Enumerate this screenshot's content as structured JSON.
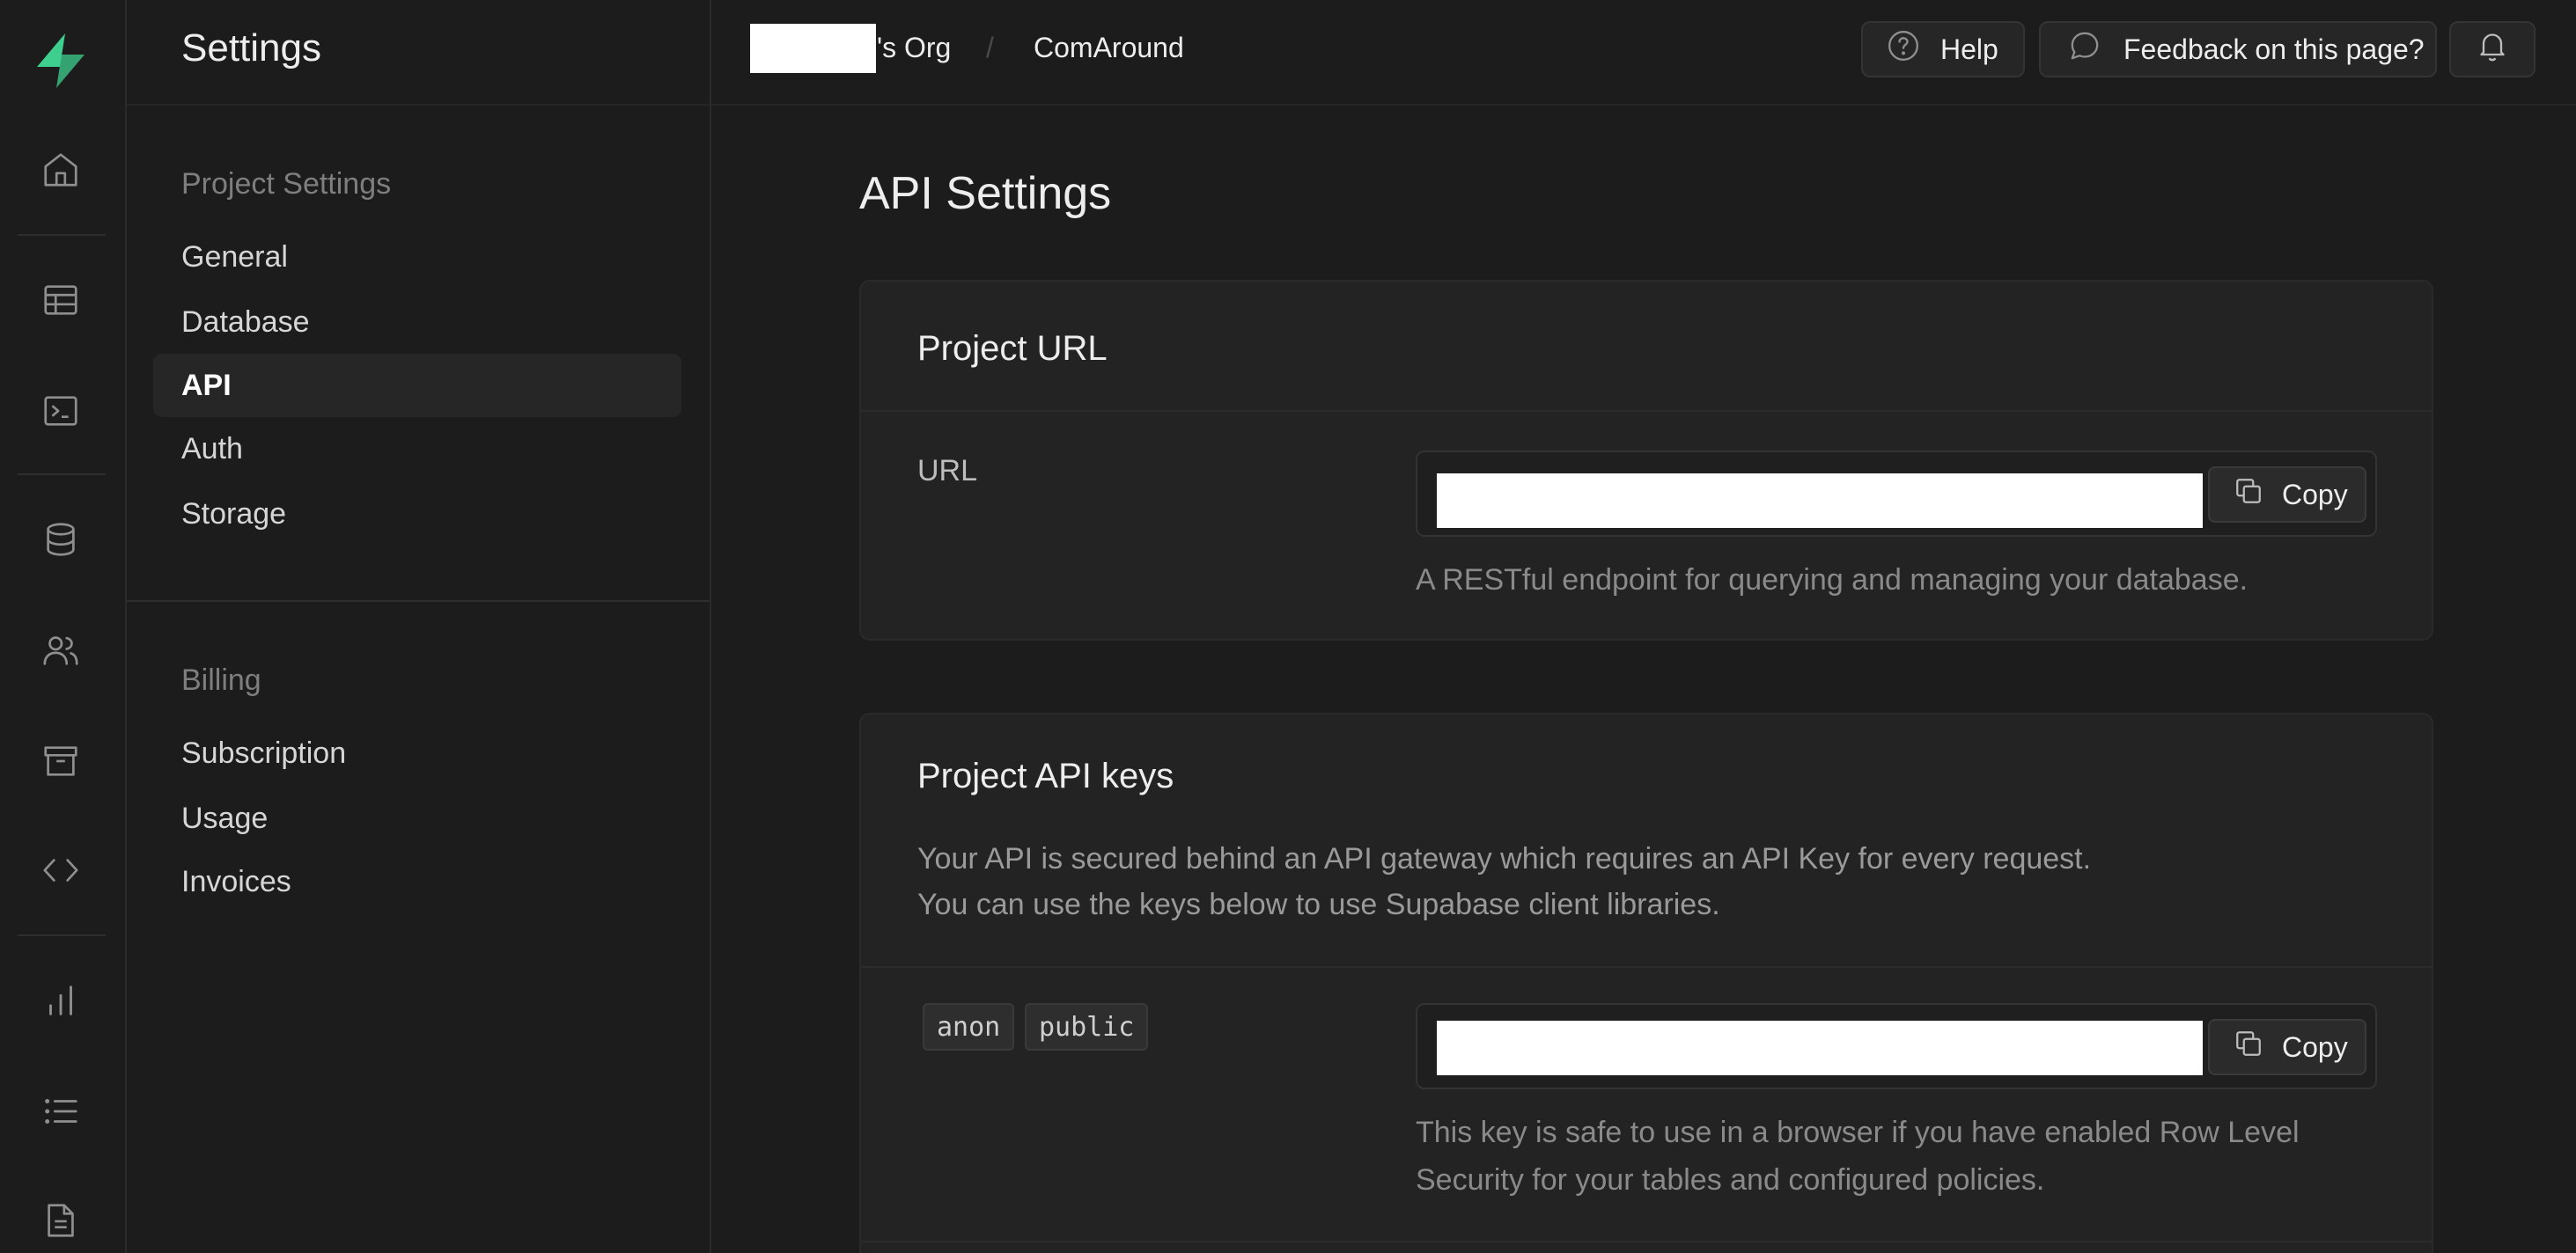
{
  "colors": {
    "brand": "#3ecf8e",
    "background": "#1c1c1c",
    "card": "#232323"
  },
  "rail": {
    "icons": [
      "supabase-logo",
      "home-icon",
      "table-editor-icon",
      "sql-editor-icon",
      "database-icon",
      "auth-users-icon",
      "storage-icon",
      "api-docs-icon",
      "reports-icon",
      "logs-icon",
      "docs-icon"
    ]
  },
  "sidebar": {
    "title": "Settings",
    "project_settings": {
      "heading": "Project Settings",
      "items": [
        {
          "label": "General",
          "active": false
        },
        {
          "label": "Database",
          "active": false
        },
        {
          "label": "API",
          "active": true
        },
        {
          "label": "Auth",
          "active": false
        },
        {
          "label": "Storage",
          "active": false
        }
      ]
    },
    "billing": {
      "heading": "Billing",
      "items": [
        {
          "label": "Subscription"
        },
        {
          "label": "Usage"
        },
        {
          "label": "Invoices"
        }
      ]
    }
  },
  "topbar": {
    "org_suffix": "'s Org",
    "separator": "/",
    "project": "ComAround",
    "help_label": "Help",
    "feedback_label": "Feedback on this page?"
  },
  "main": {
    "title": "API Settings",
    "project_url": {
      "title": "Project URL",
      "field_label": "URL",
      "copy_label": "Copy",
      "help": "A RESTful endpoint for querying and managing your database."
    },
    "api_keys": {
      "title": "Project API keys",
      "desc_line1": "Your API is secured behind an API gateway which requires an API Key for every request.",
      "desc_line2": "You can use the keys below to use Supabase client libraries.",
      "tags": [
        "anon",
        "public"
      ],
      "copy_label": "Copy",
      "help_line1": "This key is safe to use in a browser if you have enabled Row Level",
      "help_line2": "Security for your tables and configured policies."
    }
  }
}
